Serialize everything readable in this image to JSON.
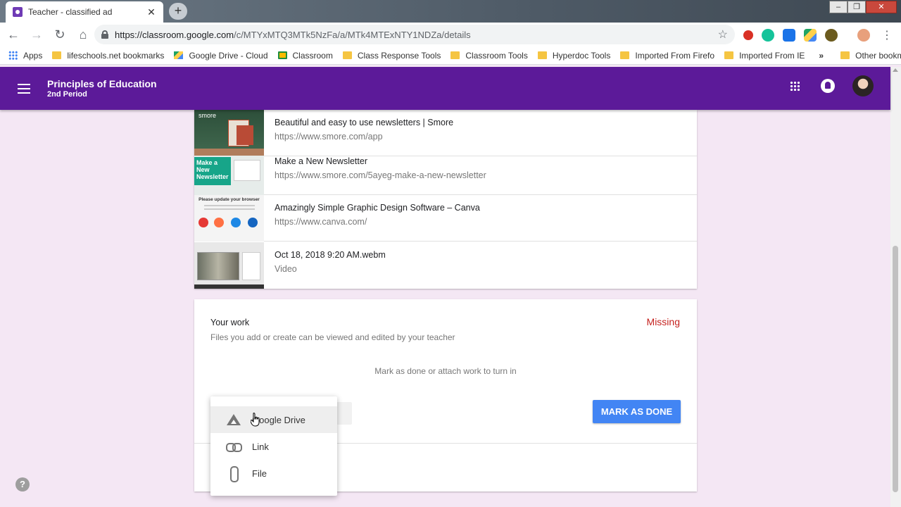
{
  "browser": {
    "tab_title": "Teacher - classified ad",
    "url_host": "https://classroom.google.com",
    "url_path": "/c/MTYxMTQ3MTk5NzFa/a/MTk4MTExNTY1NDZa/details"
  },
  "bookmarks": {
    "items": [
      {
        "label": "Apps",
        "icon": "apps-grid-icon"
      },
      {
        "label": "lifeschools.net bookmarks",
        "icon": "folder-icon"
      },
      {
        "label": "Google Drive - Cloud",
        "icon": "google-drive-icon"
      },
      {
        "label": "Classroom",
        "icon": "classroom-icon"
      },
      {
        "label": "Class Response Tools",
        "icon": "folder-icon"
      },
      {
        "label": "Classroom Tools",
        "icon": "folder-icon"
      },
      {
        "label": "Hyperdoc Tools",
        "icon": "folder-icon"
      },
      {
        "label": "Imported From Firefo",
        "icon": "folder-icon"
      },
      {
        "label": "Imported From IE",
        "icon": "folder-icon"
      }
    ],
    "overflow": "»",
    "other": "Other bookmarks"
  },
  "header": {
    "class_name": "Principles of Education",
    "section": "2nd Period"
  },
  "attachments": [
    {
      "title": "Beautiful and easy to use newsletters | Smore",
      "subtitle": "https://www.smore.com/app",
      "thumb_text": "smore"
    },
    {
      "title": "Make a New Newsletter",
      "subtitle": "https://www.smore.com/5ayeg-make-a-new-newsletter",
      "thumb_text": "Make a New Newsletter"
    },
    {
      "title": "Amazingly Simple Graphic Design Software – Canva",
      "subtitle": "https://www.canva.com/",
      "thumb_text": "Please update your browser"
    },
    {
      "title": "Oct 18, 2018 9:20 AM.webm",
      "subtitle": "Video"
    }
  ],
  "work": {
    "title": "Your work",
    "description": "Files you add or create can be viewed and edited by your teacher",
    "status": "Missing",
    "hint": "Mark as done or attach work to turn in",
    "mark_done_label": "MARK AS DONE"
  },
  "menu": {
    "items": [
      {
        "label": "Google Drive",
        "icon": "google-drive-icon"
      },
      {
        "label": "Link",
        "icon": "link-icon"
      },
      {
        "label": "File",
        "icon": "paperclip-icon"
      }
    ]
  },
  "help": {
    "label": "?"
  },
  "colors": {
    "header_purple": "#5c1a99",
    "page_bg": "#f4e7f4",
    "missing_red": "#c5221f",
    "button_blue": "#4285f4"
  }
}
